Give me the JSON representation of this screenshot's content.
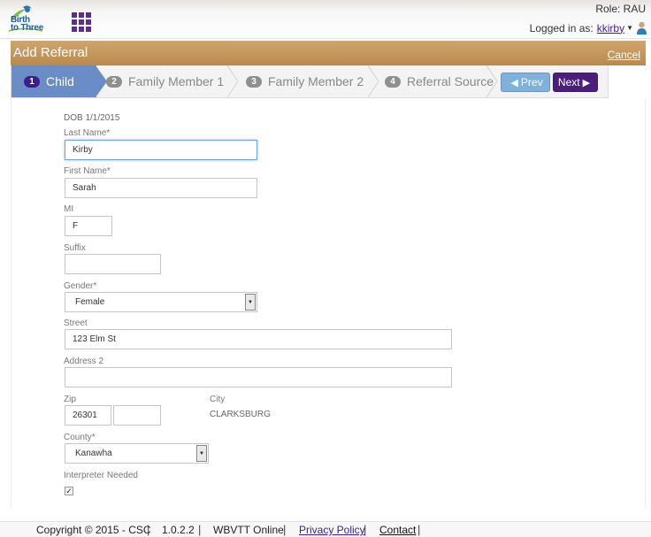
{
  "header": {
    "logo_text_line1": "Birth",
    "logo_text_line2": "to Three",
    "role_label": "Role: RAU",
    "logged_in_label": "Logged in as:",
    "username": "kkirby"
  },
  "titlebar": {
    "title": "Add Referral",
    "cancel_label": "Cancel"
  },
  "wizard": {
    "steps": [
      {
        "number": "1",
        "label": "Child",
        "active": true
      },
      {
        "number": "2",
        "label": "Family Member 1",
        "active": false
      },
      {
        "number": "3",
        "label": "Family Member 2",
        "active": false
      },
      {
        "number": "4",
        "label": "Referral Source",
        "active": false
      }
    ],
    "prev_label": "Prev",
    "next_label": "Next"
  },
  "form": {
    "dob": "DOB 1/1/2015",
    "last_name": {
      "label": "Last Name",
      "value": "Kirby"
    },
    "first_name": {
      "label": "First Name",
      "value": "Sarah"
    },
    "mi": {
      "label": "MI",
      "value": "F"
    },
    "suffix": {
      "label": "Suffix",
      "value": ""
    },
    "gender": {
      "label": "Gender",
      "value": "Female"
    },
    "street": {
      "label": "Street",
      "value": "123 Elm St"
    },
    "address2": {
      "label": "Address 2",
      "value": ""
    },
    "zip": {
      "label": "Zip",
      "value": "26301",
      "ext": ""
    },
    "city": {
      "label": "City",
      "value": "CLARKSBURG"
    },
    "county": {
      "label": "County",
      "value": "Kanawha"
    },
    "interpreter": {
      "label": "Interpreter Needed",
      "checked": true
    },
    "required_mark": "*"
  },
  "footer": {
    "copyright": "Copyright © 2015 - CSC",
    "version": "1.0.2.2",
    "app": "WBVTT Online",
    "privacy": "Privacy Policy",
    "contact": "Contact"
  },
  "colors": {
    "titlebar": "#b98a4f",
    "active_step": "#6b8dc7",
    "next_button": "#4a1f7c",
    "prev_button": "#7fb1dd"
  }
}
